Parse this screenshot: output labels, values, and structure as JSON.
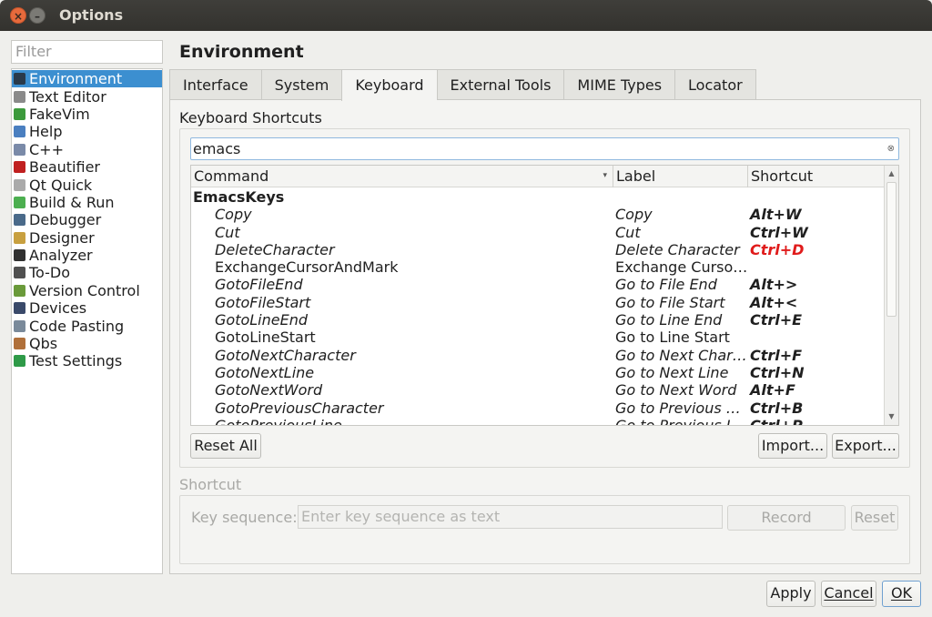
{
  "window": {
    "title": "Options",
    "close_glyph": "×",
    "minimize_glyph": "–"
  },
  "sidebar": {
    "filter_placeholder": "Filter",
    "items": [
      {
        "label": "Environment",
        "icon": "monitor-icon",
        "color": "#2a3a4a"
      },
      {
        "label": "Text Editor",
        "icon": "text-doc-icon",
        "color": "#8a8a8a"
      },
      {
        "label": "FakeVim",
        "icon": "vim-icon",
        "color": "#3c9a3c"
      },
      {
        "label": "Help",
        "icon": "help-globe-icon",
        "color": "#4a7fc0"
      },
      {
        "label": "C++",
        "icon": "cpp-icon",
        "color": "#7a8aa8"
      },
      {
        "label": "Beautifier",
        "icon": "shoe-icon",
        "color": "#c02020"
      },
      {
        "label": "Qt Quick",
        "icon": "qtquick-icon",
        "color": "#aaaaaa"
      },
      {
        "label": "Build & Run",
        "icon": "build-run-icon",
        "color": "#4caf50"
      },
      {
        "label": "Debugger",
        "icon": "debugger-icon",
        "color": "#4a6a8a"
      },
      {
        "label": "Designer",
        "icon": "designer-icon",
        "color": "#c8a040"
      },
      {
        "label": "Analyzer",
        "icon": "analyzer-icon",
        "color": "#303030"
      },
      {
        "label": "To-Do",
        "icon": "todo-icon",
        "color": "#505050"
      },
      {
        "label": "Version Control",
        "icon": "version-control-icon",
        "color": "#6a9a3a"
      },
      {
        "label": "Devices",
        "icon": "devices-icon",
        "color": "#3a4a6a"
      },
      {
        "label": "Code Pasting",
        "icon": "code-pasting-icon",
        "color": "#7a8a9a"
      },
      {
        "label": "Qbs",
        "icon": "qbs-hammer-icon",
        "color": "#b0703a"
      },
      {
        "label": "Test Settings",
        "icon": "qa-icon",
        "color": "#2e9a48"
      }
    ],
    "selected_index": 0
  },
  "main": {
    "title": "Environment",
    "tabs": [
      "Interface",
      "System",
      "Keyboard",
      "External Tools",
      "MIME Types",
      "Locator"
    ],
    "active_tab": "Keyboard",
    "group_title": "Keyboard Shortcuts",
    "search_value": "emacs",
    "table": {
      "columns": [
        "Command",
        "Label",
        "Shortcut"
      ],
      "group": "EmacsKeys",
      "rows": [
        {
          "command": "Copy",
          "label": "Copy",
          "shortcut": "Alt+W",
          "modified": true,
          "conflict": false
        },
        {
          "command": "Cut",
          "label": "Cut",
          "shortcut": "Ctrl+W",
          "modified": true,
          "conflict": false
        },
        {
          "command": "DeleteCharacter",
          "label": "Delete Character",
          "shortcut": "Ctrl+D",
          "modified": true,
          "conflict": true
        },
        {
          "command": "ExchangeCursorAndMark",
          "label": "Exchange Curso…",
          "shortcut": "",
          "modified": false,
          "conflict": false
        },
        {
          "command": "GotoFileEnd",
          "label": "Go to File End",
          "shortcut": "Alt+>",
          "modified": true,
          "conflict": false
        },
        {
          "command": "GotoFileStart",
          "label": "Go to File Start",
          "shortcut": "Alt+<",
          "modified": true,
          "conflict": false
        },
        {
          "command": "GotoLineEnd",
          "label": "Go to Line End",
          "shortcut": "Ctrl+E",
          "modified": true,
          "conflict": false
        },
        {
          "command": "GotoLineStart",
          "label": "Go to Line Start",
          "shortcut": "",
          "modified": false,
          "conflict": false
        },
        {
          "command": "GotoNextCharacter",
          "label": "Go to Next Char…",
          "shortcut": "Ctrl+F",
          "modified": true,
          "conflict": false
        },
        {
          "command": "GotoNextLine",
          "label": "Go to Next Line",
          "shortcut": "Ctrl+N",
          "modified": true,
          "conflict": false
        },
        {
          "command": "GotoNextWord",
          "label": "Go to Next Word",
          "shortcut": "Alt+F",
          "modified": true,
          "conflict": false
        },
        {
          "command": "GotoPreviousCharacter",
          "label": "Go to Previous C…",
          "shortcut": "Ctrl+B",
          "modified": true,
          "conflict": false
        },
        {
          "command": "GotoPreviousLine",
          "label": "Go to Previous Line",
          "shortcut": "Ctrl+P",
          "modified": true,
          "conflict": false
        }
      ]
    },
    "buttons": {
      "reset_all": "Reset All",
      "import": "Import...",
      "export": "Export..."
    },
    "shortcut_section": {
      "title": "Shortcut",
      "key_sequence_label": "Key sequence:",
      "key_sequence_placeholder": "Enter key sequence as text",
      "record": "Record",
      "reset": "Reset"
    }
  },
  "footer": {
    "apply": "Apply",
    "cancel": "Cancel",
    "ok": "OK"
  },
  "colors": {
    "selection": "#3c8fd0",
    "conflict": "#e01b1b",
    "titlebar": "#3a3935"
  }
}
